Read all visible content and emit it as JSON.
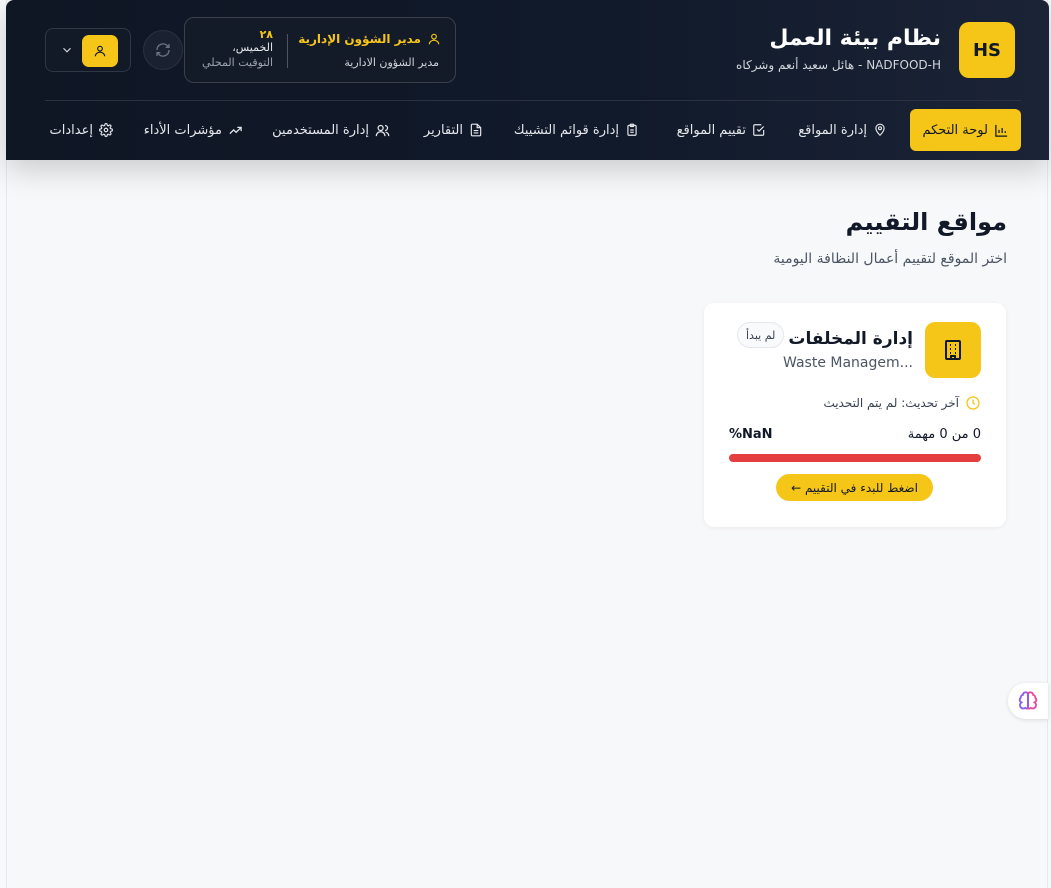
{
  "brand": {
    "logo_text": "HS",
    "title": "نظام بيئة العمل",
    "subtitle": "NADFOOD-H - هائل سعيد أنعم وشركاه"
  },
  "user": {
    "role_title": "مدير الشؤون الإدارية",
    "role_subtitle": "مدير الشؤون الادارية",
    "day_number": "٢٨",
    "day_name": "الخميس،",
    "time_label": "التوقيت المحلي"
  },
  "nav": {
    "items": [
      {
        "label": "لوحة التحكم",
        "icon": "bar-chart-icon",
        "active": true
      },
      {
        "label": "إدارة المواقع",
        "icon": "map-pin-icon"
      },
      {
        "label": "تقييم المواقع",
        "icon": "check-square-icon"
      },
      {
        "label": "إدارة قوائم التشييك",
        "icon": "clipboard-icon"
      },
      {
        "label": "التقارير",
        "icon": "file-text-icon"
      },
      {
        "label": "إدارة المستخدمين",
        "icon": "users-icon"
      },
      {
        "label": "مؤشرات الأداء",
        "icon": "trending-up-icon"
      },
      {
        "label": "إعدادات",
        "icon": "gear-icon"
      }
    ]
  },
  "page": {
    "title": "مواقع التقييم",
    "subtitle": "اختر الموقع لتقييم أعمال النظافة اليومية"
  },
  "site_card": {
    "name": "إدارة المخلفات",
    "english_name": "Waste Managem...",
    "status_badge": "لم يبدأ",
    "last_update": "آخر تحديث: لم يتم التحديث",
    "tasks": "0 من 0 مهمة",
    "percent": "%NaN",
    "start_button": "اضغط للبدء في التقييم ←"
  },
  "colors": {
    "accent": "#f5c518",
    "header_bg": "#111a2b",
    "progress_bar": "#e53e3e"
  }
}
